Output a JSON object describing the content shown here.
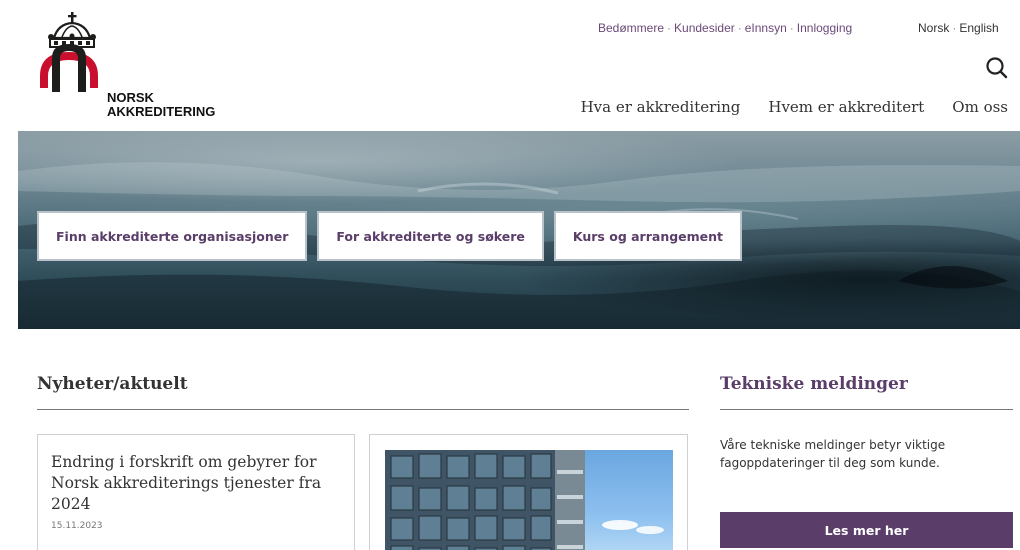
{
  "brand": {
    "name_line1": "NORSK",
    "name_line2": "AKKREDITERING",
    "colors": {
      "primary_purple": "#5a3d68",
      "logo_red": "#c8102e",
      "logo_dark": "#1d1d1b"
    }
  },
  "util_nav": {
    "items": [
      "Bedømmere",
      "Kundesider",
      "eInnsyn",
      "Innlogging"
    ],
    "separator": "·"
  },
  "lang_nav": {
    "items": [
      "Norsk",
      "English"
    ],
    "separator": "·"
  },
  "search": {
    "icon": "search-icon"
  },
  "main_nav": {
    "items": [
      "Hva er akkreditering",
      "Hvem er akkreditert",
      "Om oss"
    ]
  },
  "hero": {
    "buttons": [
      "Finn akkrediterte organisasjoner",
      "For akkrediterte og søkere",
      "Kurs og arrangement"
    ]
  },
  "news": {
    "title": "Nyheter/aktuelt",
    "cards": [
      {
        "headline": "Endring i forskrift om gebyrer for Norsk akkrediterings tjenester fra 2024",
        "date": "15.11.2023"
      }
    ]
  },
  "tech": {
    "title": "Tekniske meldinger",
    "text": "Våre tekniske meldinger betyr viktige fagoppdateringer til deg som kunde.",
    "button": "Les mer her"
  }
}
